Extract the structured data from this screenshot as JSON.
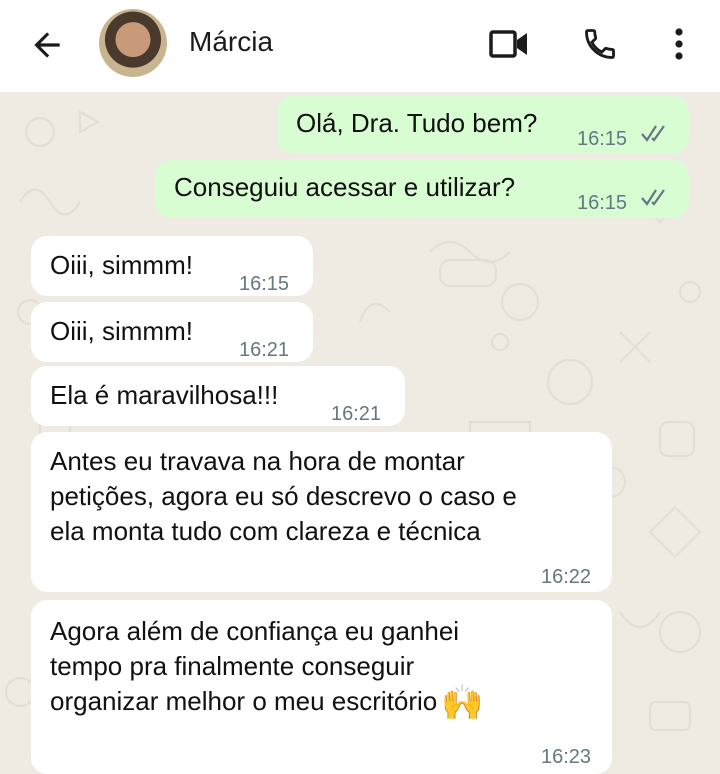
{
  "header": {
    "contact_name": "Márcia",
    "icons": [
      "arrow-back-icon",
      "video-call-icon",
      "phone-icon",
      "more-vertical-icon"
    ]
  },
  "messages": [
    {
      "direction": "outgoing",
      "text": "Olá, Dra. Tudo bem?",
      "time": "16:15",
      "status": "read"
    },
    {
      "direction": "outgoing",
      "text": "Conseguiu acessar e utilizar?",
      "time": "16:15",
      "status": "read"
    },
    {
      "direction": "incoming",
      "text": "Oiii, simmm!",
      "time": "16:15"
    },
    {
      "direction": "incoming",
      "text": "Oiii, simmm!",
      "time": "16:21"
    },
    {
      "direction": "incoming",
      "text": "Ela é maravilhosa!!!",
      "time": "16:21"
    },
    {
      "direction": "incoming",
      "lines": [
        "Antes eu travava na hora de montar",
        "petições, agora eu só descrevo o caso e",
        "ela monta tudo com clareza e técnica"
      ],
      "time": "16:22"
    },
    {
      "direction": "incoming",
      "lines": [
        "Agora além de confiança eu ganhei",
        "tempo pra finalmente conseguir",
        "organizar melhor o meu escritório"
      ],
      "emoji": "🙌",
      "time": "16:23"
    }
  ],
  "colors": {
    "outgoing_bubble": "#d9fdd3",
    "incoming_bubble": "#ffffff",
    "chat_background": "#efeae2",
    "read_ticks": "#53bdeb"
  }
}
